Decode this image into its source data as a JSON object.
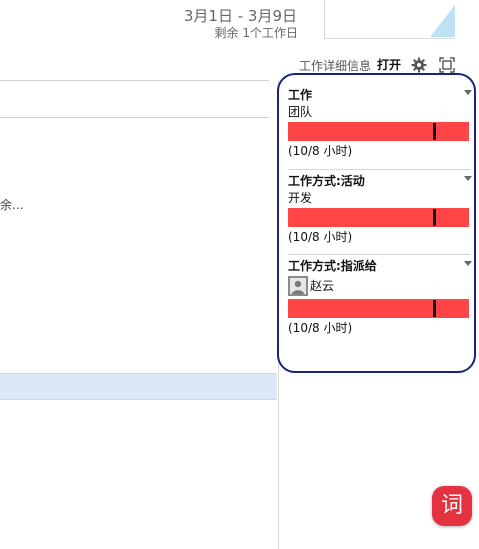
{
  "header": {
    "date_range": "3月1日 - 3月9日",
    "remaining": "剩余 1个工作日"
  },
  "left": {
    "truncated_text": "余..."
  },
  "panel": {
    "title": "工作详细信息",
    "open_label": "打开",
    "icons": [
      "gear-icon",
      "expand-icon"
    ],
    "sections": [
      {
        "title": "工作",
        "label": "团队",
        "hours": "(10/8 小时)",
        "progress_fraction": 1.25,
        "marker_fraction": 0.8,
        "bar_color": "#ff4545"
      },
      {
        "title": "工作方式:活动",
        "label": "开发",
        "hours": "(10/8 小时)",
        "progress_fraction": 1.25,
        "marker_fraction": 0.8,
        "bar_color": "#ff4545"
      },
      {
        "title": "工作方式:指派给",
        "label": "赵云",
        "hours": "(10/8 小时)",
        "progress_fraction": 1.25,
        "marker_fraction": 0.8,
        "bar_color": "#ff4545"
      }
    ]
  },
  "fab": {
    "glyph": "词"
  },
  "colors": {
    "bar": "#ff4545",
    "highlight_border": "#1a237e",
    "selection": "#dbe8f8",
    "fab": "#e53241"
  }
}
